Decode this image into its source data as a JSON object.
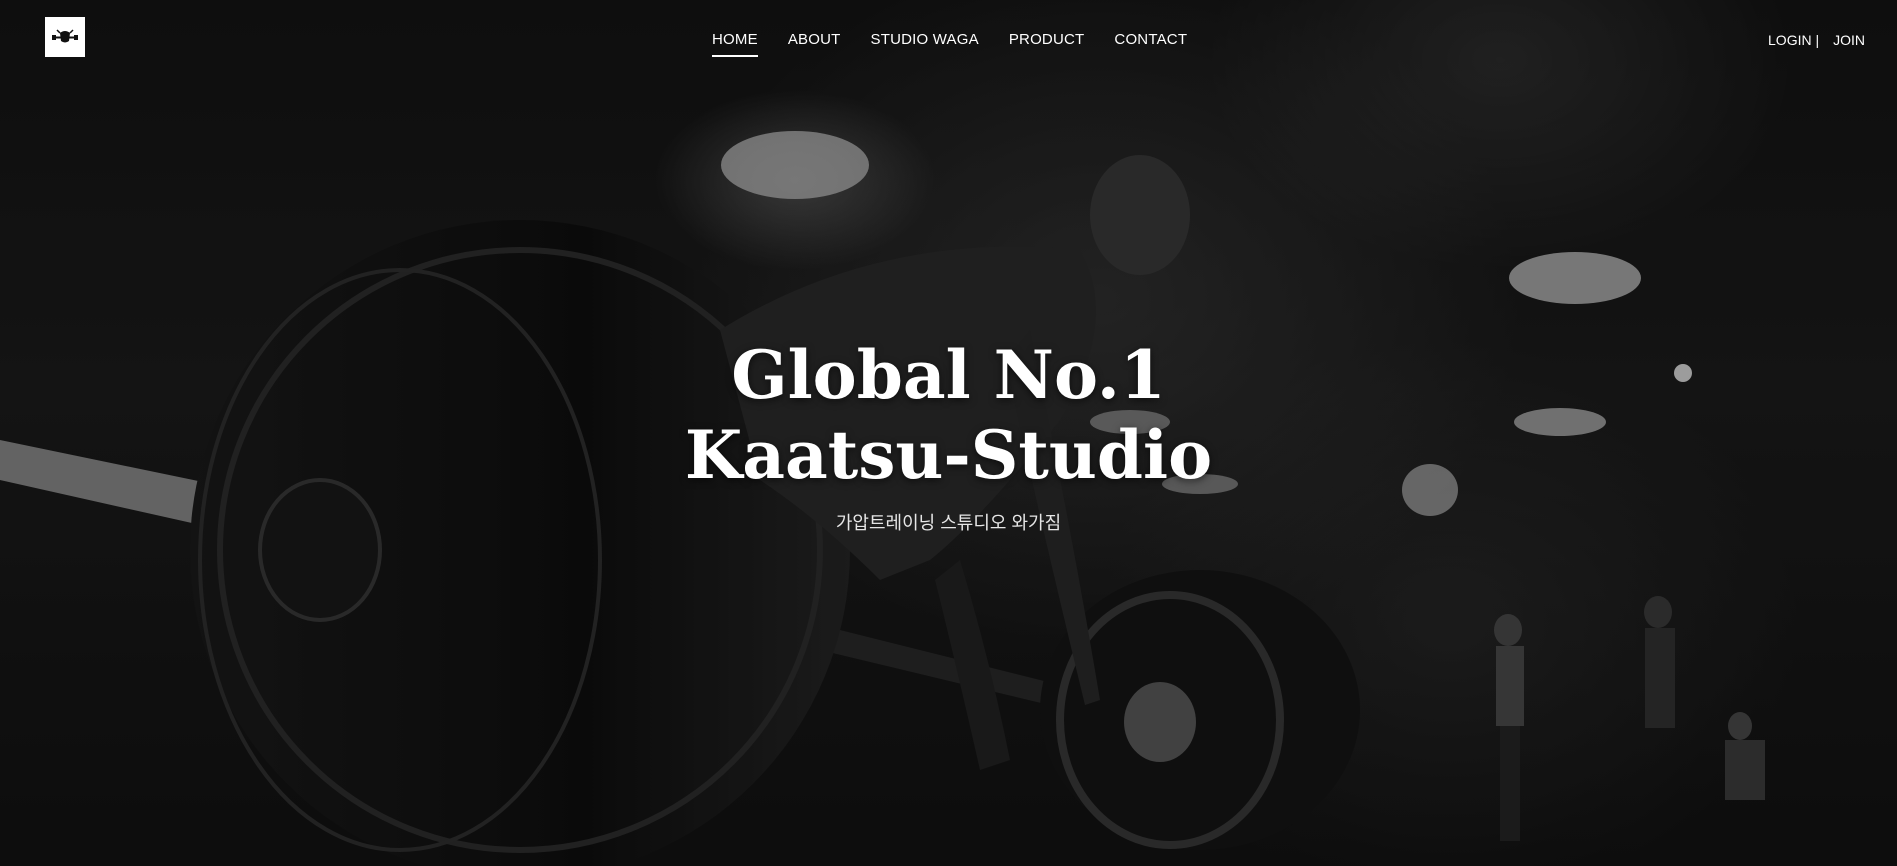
{
  "brand": {
    "logo_icon": "dumbbell-bull-logo-icon"
  },
  "nav": {
    "items": [
      {
        "label": "HOME",
        "active": true
      },
      {
        "label": "ABOUT",
        "active": false
      },
      {
        "label": "STUDIO WAGA",
        "active": false
      },
      {
        "label": "PRODUCT",
        "active": false
      },
      {
        "label": "CONTACT",
        "active": false
      }
    ]
  },
  "auth": {
    "login_label": "LOGIN |",
    "join_label": "JOIN"
  },
  "hero": {
    "title_line1": "Global No.1",
    "title_line2": "Kaatsu-Studio",
    "subtitle": "가압트레이닝 스튜디오 와가짐"
  },
  "colors": {
    "text": "#ffffff",
    "background": "#141414",
    "logo_bg": "#ffffff"
  }
}
